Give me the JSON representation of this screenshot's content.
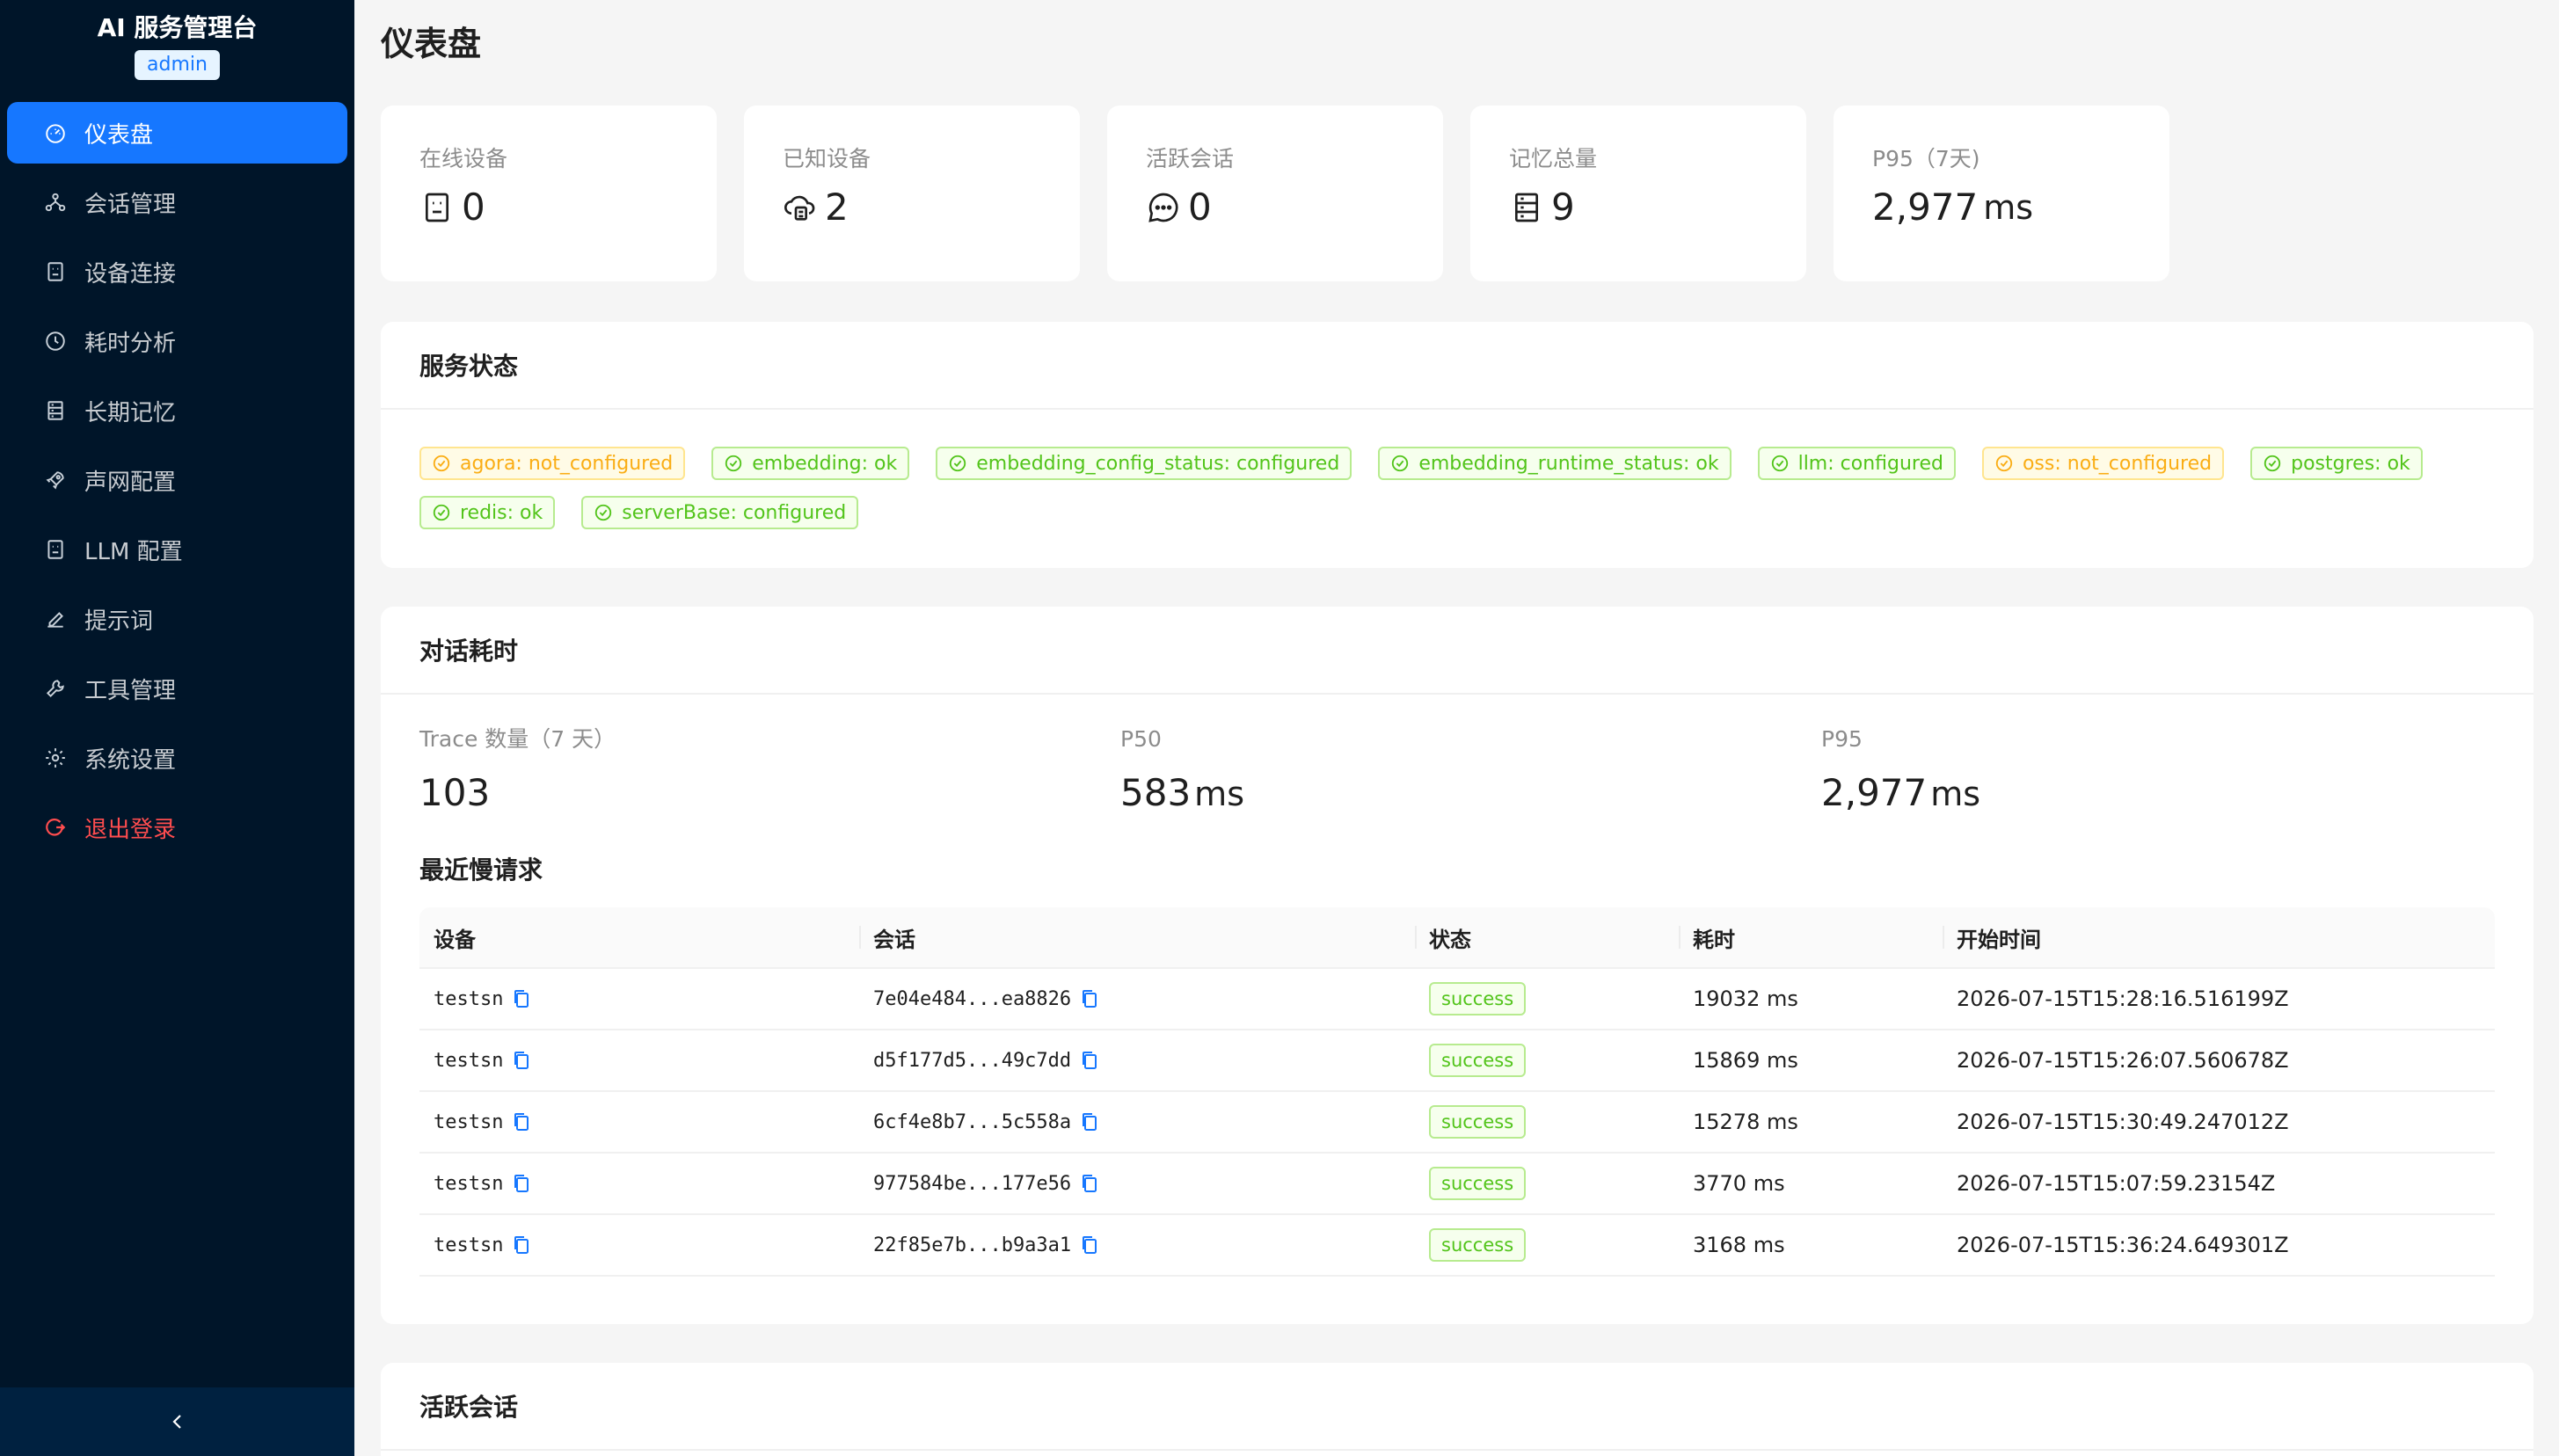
{
  "sidebar": {
    "title": "AI 服务管理台",
    "role_badge": "admin",
    "items": [
      {
        "label": "仪表盘"
      },
      {
        "label": "会话管理"
      },
      {
        "label": "设备连接"
      },
      {
        "label": "耗时分析"
      },
      {
        "label": "长期记忆"
      },
      {
        "label": "声网配置"
      },
      {
        "label": "LLM 配置"
      },
      {
        "label": "提示词"
      },
      {
        "label": "工具管理"
      },
      {
        "label": "系统设置"
      },
      {
        "label": "退出登录"
      }
    ]
  },
  "page": {
    "title": "仪表盘"
  },
  "stats": [
    {
      "label": "在线设备",
      "value": "0"
    },
    {
      "label": "已知设备",
      "value": "2"
    },
    {
      "label": "活跃会话",
      "value": "0"
    },
    {
      "label": "记忆总量",
      "value": "9"
    },
    {
      "label": "P95（7天)",
      "value": "2,977",
      "unit": "ms"
    }
  ],
  "service_status": {
    "title": "服务状态",
    "tags": [
      {
        "text": "agora: not_configured",
        "state": "warn"
      },
      {
        "text": "embedding: ok",
        "state": "ok"
      },
      {
        "text": "embedding_config_status: configured",
        "state": "ok"
      },
      {
        "text": "embedding_runtime_status: ok",
        "state": "ok"
      },
      {
        "text": "llm: configured",
        "state": "ok"
      },
      {
        "text": "oss: not_configured",
        "state": "warn"
      },
      {
        "text": "postgres: ok",
        "state": "ok"
      },
      {
        "text": "redis: ok",
        "state": "ok"
      },
      {
        "text": "serverBase: configured",
        "state": "ok"
      }
    ]
  },
  "latency": {
    "title": "对话耗时",
    "metrics": [
      {
        "label": "Trace 数量（7 天）",
        "value": "103",
        "unit": ""
      },
      {
        "label": "P50",
        "value": "583",
        "unit": "ms"
      },
      {
        "label": "P95",
        "value": "2,977",
        "unit": "ms"
      }
    ],
    "slow_title": "最近慢请求",
    "columns": [
      "设备",
      "会话",
      "状态",
      "耗时",
      "开始时间"
    ],
    "rows": [
      {
        "device": "testsn",
        "session": "7e04e484...ea8826",
        "status": "success",
        "duration": "19032 ms",
        "start": "2026-07-15T15:28:16.516199Z"
      },
      {
        "device": "testsn",
        "session": "d5f177d5...49c7dd",
        "status": "success",
        "duration": "15869 ms",
        "start": "2026-07-15T15:26:07.560678Z"
      },
      {
        "device": "testsn",
        "session": "6cf4e8b7...5c558a",
        "status": "success",
        "duration": "15278 ms",
        "start": "2026-07-15T15:30:49.247012Z"
      },
      {
        "device": "testsn",
        "session": "977584be...177e56",
        "status": "success",
        "duration": "3770 ms",
        "start": "2026-07-15T15:07:59.23154Z"
      },
      {
        "device": "testsn",
        "session": "22f85e7b...b9a3a1",
        "status": "success",
        "duration": "3168 ms",
        "start": "2026-07-15T15:36:24.649301Z"
      }
    ]
  },
  "active_sessions": {
    "title": "活跃会话"
  },
  "colors": {
    "sidebar_bg": "#001529",
    "primary": "#1677ff",
    "success": "#52c41a",
    "warning": "#faad14",
    "danger": "#ff4d4f"
  }
}
